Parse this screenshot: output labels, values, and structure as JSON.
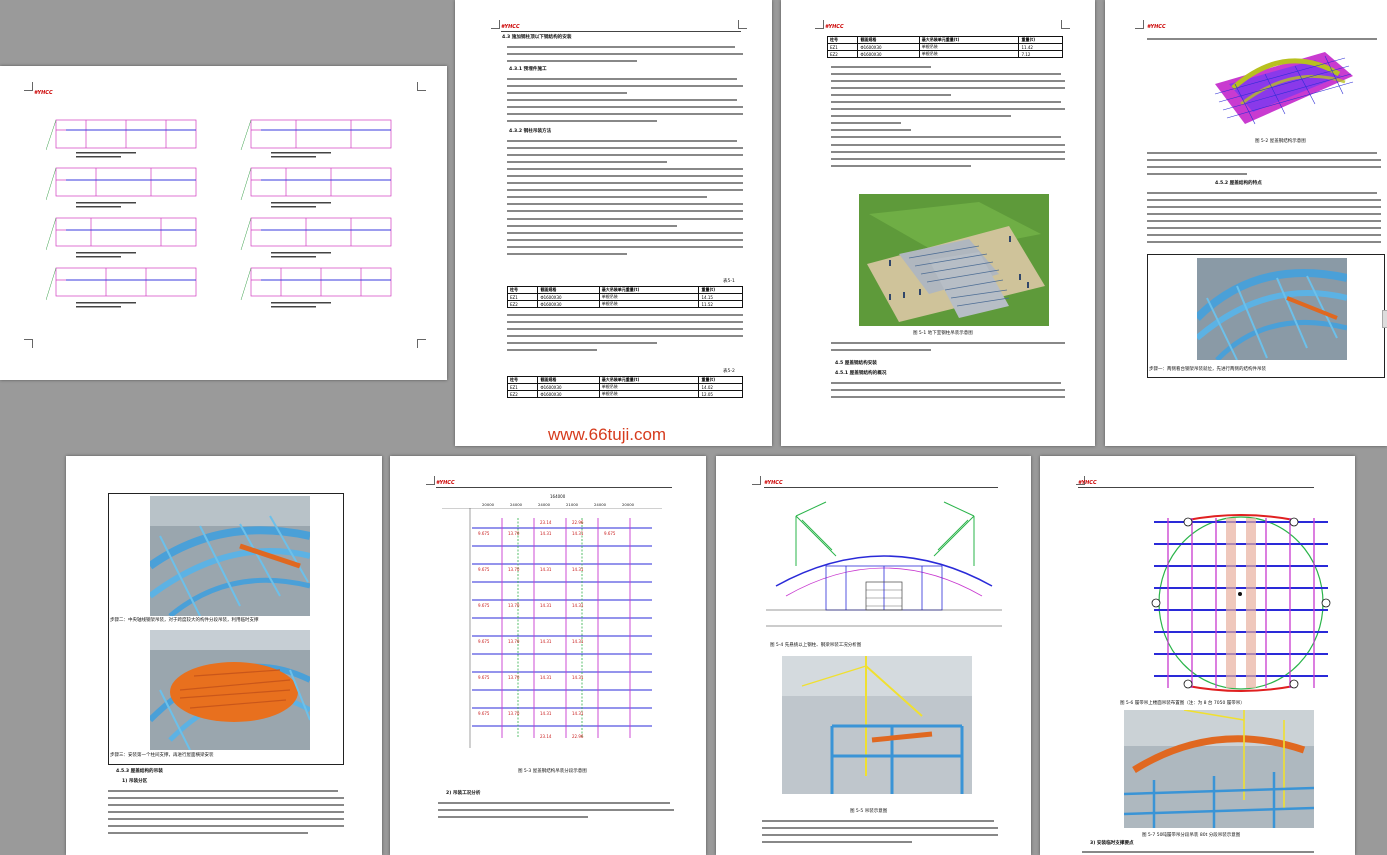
{
  "watermark": "www.66tuji.com",
  "logo": "#YHCC",
  "page2": {
    "h1": "4.3 施加钢柱顶以下钢结构的安装",
    "h2": "4.3.1 预埋件施工",
    "h3": "4.3.2 钢柱吊装方法",
    "cap_table1": "表5-1",
    "cap_table2": "表5-2",
    "table1": [
      [
        "柱号",
        "截面规格",
        "最大吊装单元重量(t)",
        "重量(t)"
      ],
      [
        "EZ1",
        "Φ1600X30",
        "单根吊装",
        "14.15"
      ],
      [
        "EZ2",
        "Φ1600X30",
        "单根吊装",
        "11.52"
      ]
    ],
    "table2": [
      [
        "柱号",
        "截面规格",
        "最大吊装单元重量(t)",
        "重量(t)"
      ],
      [
        "EZ1",
        "Φ1600X30",
        "单根吊装",
        "14.02"
      ],
      [
        "EZ2",
        "Φ1600X30",
        "单根吊装",
        "12.05"
      ]
    ]
  },
  "page3": {
    "table": [
      [
        "柱号",
        "截面规格",
        "最大吊装单元重量(t)",
        "重量(t)"
      ],
      [
        "EZ1",
        "Φ1600X30",
        "单根吊装",
        "11.42"
      ],
      [
        "EZ2",
        "Φ1600X30",
        "单根吊装",
        "7.12"
      ]
    ],
    "cap_fig": "图 5-1  地下室钢柱吊装示意图",
    "h1": "4.5 屋盖钢结构安装",
    "h2": "4.5.1 屋盖钢结构的概况"
  },
  "page4": {
    "cap_fig1": "图 5-2 屋盖钢结构示意图",
    "h1": "4.5.2 屋盖结构的特点",
    "cap_step": "步骤一：两侧看台钢架吊装就位，先进行两侧的结构件吊装"
  },
  "page5": {
    "cap_step2": "步骤二：中央轴线钢架吊装，对于跨度较大的构件分段吊装，利用临时支撑",
    "cap_step3": "步骤三：安装第一个柱间支撑，再进行屋面横梁安装",
    "h1": "4.5.3 屋盖结构的吊装",
    "h2": "1) 吊装分区"
  },
  "page6": {
    "dims": [
      "20000",
      "24000",
      "24000",
      "21000",
      "24000",
      "20000"
    ],
    "dim_total": "164000",
    "cap_fig": "图 5-3 屋盖钢结构吊装分段示意图",
    "h1": "2) 吊装工况分析",
    "weights": [
      "23.14",
      "22.96",
      "14.31",
      "20.61",
      "9.675",
      "13.70",
      "14.31",
      "12.96"
    ]
  },
  "page7": {
    "cap_fig1": "图 5-4 先悬挑以上钢柱、钢梁吊装工况分析图",
    "cap_fig2": "图 5-5  吊装示意图"
  },
  "page8": {
    "cap_fig1": "图 5-6  履带吊上楼面吊装布置图（注：为 8 台 7050 履带吊）",
    "cap_fig2": "图 5-7  50吨履带吊分段吊装 80t 分段吊装示意图",
    "h1": "3) 安装临时支撑要点"
  }
}
